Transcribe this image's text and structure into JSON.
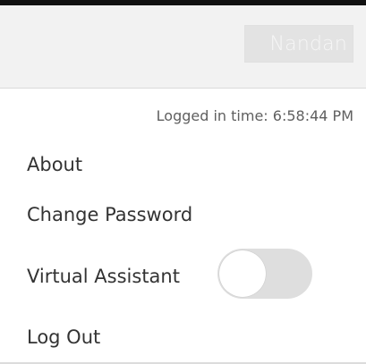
{
  "header": {
    "user_name": "Nandan"
  },
  "menu": {
    "logged_in_text": "Logged in time: 6:58:44 PM",
    "items": [
      {
        "label": "About"
      },
      {
        "label": "Change Password"
      },
      {
        "label": "Virtual Assistant"
      },
      {
        "label": "Log Out"
      }
    ],
    "virtual_assistant_toggle": {
      "enabled": false
    }
  },
  "colors": {
    "header_background": "#f2f2f2",
    "toggle_track": "#dedede",
    "toggle_knob": "#ffffff"
  }
}
